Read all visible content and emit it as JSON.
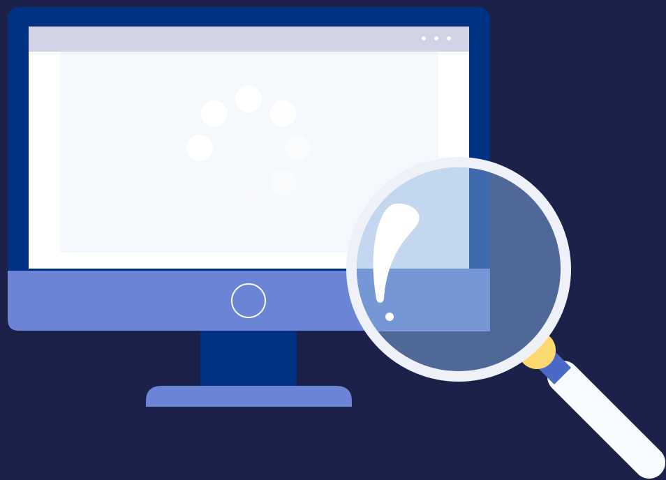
{
  "scene": {
    "subject": "monitor-with-magnifier",
    "loading": true
  },
  "colors": {
    "background": "#1c2149",
    "monitor_frame": "#013182",
    "monitor_chin": "#6c84d6",
    "stand_neck": "#013182",
    "stand_base": "#6c84d6",
    "screen_outer": "#ffffff",
    "screen_inner": "#f4f7fb",
    "title_bar": "#d2d4e6",
    "window_dots": "#ffffff",
    "spinner": "#ffffff",
    "lens_rim": "#eef2f8",
    "lens_glass": "#4f6897",
    "handle": "#f7fafe",
    "handle_band": "#4a6ac8",
    "handle_ring": "#fbd96e"
  },
  "window_controls": {
    "dot_count": 3
  },
  "spinner": {
    "dot_count": 8
  }
}
